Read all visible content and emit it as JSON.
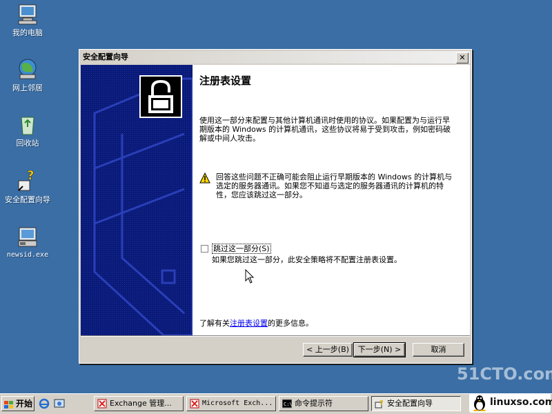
{
  "desktop": {
    "icons": [
      {
        "label": "我的电脑",
        "icon": "my-computer-icon"
      },
      {
        "label": "网上邻居",
        "icon": "network-places-icon"
      },
      {
        "label": "回收站",
        "icon": "recycle-bin-icon"
      },
      {
        "label": "安全配置向导",
        "icon": "security-wizard-icon"
      },
      {
        "label": "newsid.exe",
        "icon": "exe-file-icon"
      }
    ]
  },
  "dialog": {
    "title": "安全配置向导",
    "heading": "注册表设置",
    "paragraph": "使用这一部分来配置与其他计算机通讯时使用的协议。如果配置为与运行早期版本的 Windows 的计算机通讯，这些协议将易于受到攻击，例如密码破解或中间人攻击。",
    "warning": "回答这些问题不正确可能会阻止运行早期版本的 Windows 的计算机与选定的服务器通讯。如果您不知道与选定的服务器通讯的计算机的特性，您应该跳过这一部分。",
    "skip_checkbox_label": "跳过这一部分(S)",
    "skip_checkbox_checked": false,
    "skip_description": "如果您跳过这一部分，此安全策略将不配置注册表设置。",
    "more_info_prefix": "了解有关",
    "more_info_link": "注册表设置",
    "more_info_suffix": "的更多信息。",
    "buttons": {
      "back": "< 上一步(B)",
      "next": "下一步(N) >",
      "cancel": "取消"
    }
  },
  "taskbar": {
    "start_label": "开始",
    "tasks": [
      {
        "label": "Exchange 管理...",
        "icon": "exchange-icon",
        "active": false
      },
      {
        "label": "Microsoft Exch...",
        "icon": "exchange-icon",
        "active": false
      },
      {
        "label": "命令提示符",
        "icon": "cmd-icon",
        "active": false
      },
      {
        "label": "安全配置向导",
        "icon": "security-wizard-icon",
        "active": true
      }
    ]
  },
  "watermark": {
    "site1": "51CTO.com",
    "site2": "linuxso.com"
  }
}
